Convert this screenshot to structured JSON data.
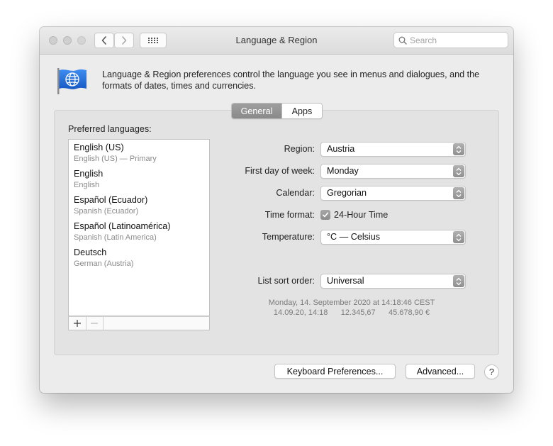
{
  "window": {
    "title": "Language & Region",
    "search_placeholder": "Search"
  },
  "header": {
    "icon": "globe-flag-icon",
    "description": "Language & Region preferences control the language you see in menus and dialogues, and the formats of dates, times and currencies."
  },
  "tabs": [
    {
      "label": "General",
      "selected": true
    },
    {
      "label": "Apps",
      "selected": false
    }
  ],
  "preferred_languages": {
    "label": "Preferred languages:",
    "items": [
      {
        "name": "English (US)",
        "sub": "English (US) — Primary"
      },
      {
        "name": "English",
        "sub": "English"
      },
      {
        "name": "Español (Ecuador)",
        "sub": "Spanish (Ecuador)"
      },
      {
        "name": "Español (Latinoamérica)",
        "sub": "Spanish (Latin America)"
      },
      {
        "name": "Deutsch",
        "sub": "German (Austria)"
      }
    ],
    "add_label": "+",
    "remove_label": "—"
  },
  "settings": {
    "region": {
      "label": "Region:",
      "value": "Austria"
    },
    "first_day": {
      "label": "First day of week:",
      "value": "Monday"
    },
    "calendar": {
      "label": "Calendar:",
      "value": "Gregorian"
    },
    "time_format": {
      "label": "Time format:",
      "checkbox_label": "24-Hour Time",
      "checked": true
    },
    "temperature": {
      "label": "Temperature:",
      "value": "°C — Celsius"
    },
    "list_sort": {
      "label": "List sort order:",
      "value": "Universal"
    }
  },
  "sample": {
    "line1": "Monday, 14. September 2020 at 14:18:46 CEST",
    "line2": "14.09.20, 14:18      12.345,67      45.678,90 €"
  },
  "buttons": {
    "keyboard": "Keyboard Preferences...",
    "advanced": "Advanced...",
    "help": "?"
  },
  "colors": {
    "flag_blue": "#1f6fd6",
    "selected_tab": "#8f8f8f"
  }
}
